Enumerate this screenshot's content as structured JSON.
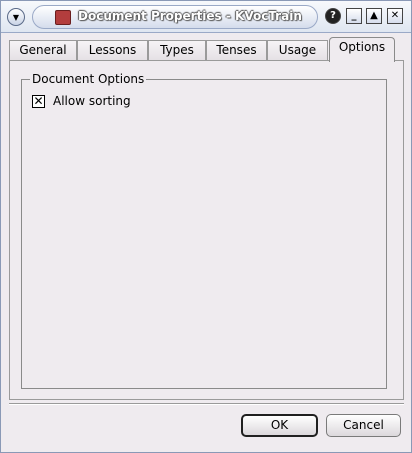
{
  "window": {
    "title": "Document Properties - KVocTrain"
  },
  "titlebar": {
    "help_glyph": "?",
    "minimize_glyph": "_",
    "maximize_glyph": "▲",
    "close_glyph": "✕"
  },
  "tabs": [
    {
      "label": "General",
      "mnemonic": "G",
      "active": false
    },
    {
      "label": "Lessons",
      "mnemonic": "e",
      "active": false
    },
    {
      "label": "Types",
      "mnemonic": "y",
      "active": false
    },
    {
      "label": "Tenses",
      "mnemonic": "n",
      "active": false
    },
    {
      "label": "Usage",
      "mnemonic": "U",
      "active": false
    },
    {
      "label": "Options",
      "mnemonic": "O",
      "active": true
    }
  ],
  "options": {
    "group_title": "Document Options",
    "allow_sorting": {
      "label": "Allow sorting",
      "mnemonic": "w",
      "checked": true
    }
  },
  "buttons": {
    "ok": "OK",
    "cancel": "Cancel"
  }
}
